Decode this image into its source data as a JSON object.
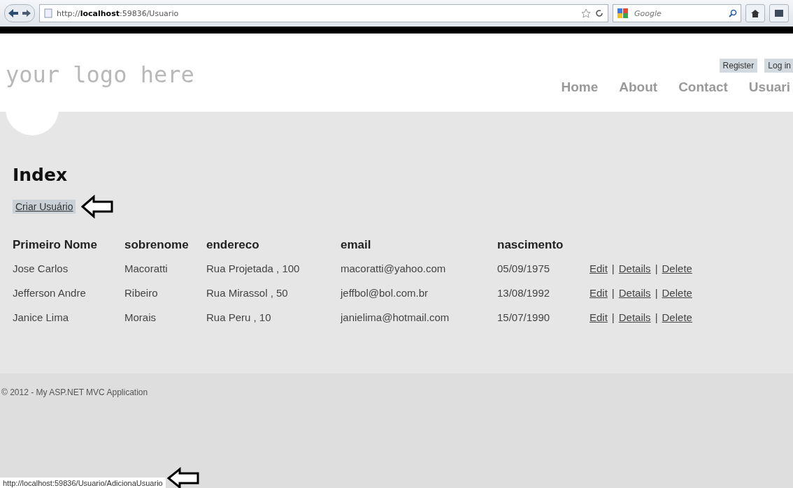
{
  "browser": {
    "address": "http://**localhost**:59836/Usuario",
    "search_placeholder": "Google"
  },
  "header": {
    "logo": "your logo here",
    "account_links": [
      "Register",
      "Log in"
    ],
    "nav": [
      "Home",
      "About",
      "Contact",
      "Usuari"
    ]
  },
  "page": {
    "title": "Index",
    "create_link": "Criar Usuário",
    "table": {
      "columns": [
        "Primeiro Nome",
        "sobrenome",
        "endereco",
        "email",
        "nascimento"
      ],
      "rows": [
        {
          "cells": [
            "Jose Carlos",
            "Macoratti",
            "Rua Projetada , 100",
            "macoratti@yahoo.com",
            "05/09/1975"
          ],
          "actions": [
            {
              "kind": "link",
              "text": "Edit"
            },
            {
              "kind": "separator",
              "text": "|"
            },
            {
              "kind": "link",
              "text": "Details"
            },
            {
              "kind": "separator",
              "text": "|"
            },
            {
              "kind": "link",
              "text": "Delete"
            }
          ]
        },
        {
          "cells": [
            "Jefferson Andre",
            "Ribeiro",
            "Rua Mirassol , 50",
            "jeffbol@bol.com.br",
            "13/08/1992"
          ],
          "actions": [
            {
              "kind": "link",
              "text": "Edit"
            },
            {
              "kind": "separator",
              "text": "|"
            },
            {
              "kind": "link",
              "text": "Details"
            },
            {
              "kind": "separator",
              "text": "|"
            },
            {
              "kind": "link",
              "text": "Delete"
            }
          ]
        },
        {
          "cells": [
            "Janice Lima",
            "Morais",
            "Rua Peru , 10",
            "janielima@hotmail.com",
            "15/07/1990"
          ],
          "actions": [
            {
              "kind": "link",
              "text": "Edit"
            },
            {
              "kind": "separator",
              "text": "|"
            },
            {
              "kind": "link",
              "text": "Details"
            },
            {
              "kind": "separator",
              "text": "|"
            },
            {
              "kind": "link",
              "text": "Delete"
            }
          ]
        }
      ]
    }
  },
  "footer": {
    "text": "© 2012 - My ASP.NET MVC Application"
  },
  "status_bar": {
    "url": "http://localhost:59836/Usuario/AdicionaUsuario"
  }
}
